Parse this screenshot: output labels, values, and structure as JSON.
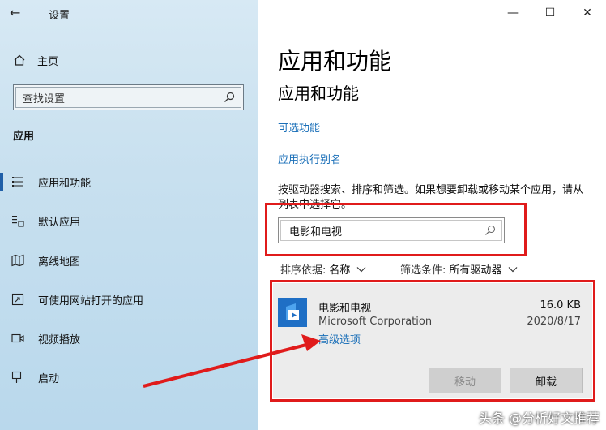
{
  "window": {
    "title": "设置",
    "back_glyph": "←",
    "minimize_glyph": "—",
    "maximize_glyph": "☐",
    "close_glyph": "✕"
  },
  "sidebar": {
    "home_label": "主页",
    "search_placeholder": "查找设置",
    "section_label": "应用",
    "items": [
      {
        "label": "应用和功能",
        "icon": "apps-features-icon",
        "active": true
      },
      {
        "label": "默认应用",
        "icon": "default-apps-icon",
        "active": false
      },
      {
        "label": "离线地图",
        "icon": "offline-maps-icon",
        "active": false
      },
      {
        "label": "可使用网站打开的应用",
        "icon": "apps-for-websites-icon",
        "active": false
      },
      {
        "label": "视频播放",
        "icon": "video-playback-icon",
        "active": false
      },
      {
        "label": "启动",
        "icon": "startup-icon",
        "active": false
      }
    ]
  },
  "main": {
    "page_title": "应用和功能",
    "section_title": "应用和功能",
    "link_optional_features": "可选功能",
    "link_app_aliases": "应用执行别名",
    "description": "按驱动器搜索、排序和筛选。如果想要卸载或移动某个应用，请从列表中选择它。",
    "search_value": "电影和电视",
    "sort_label": "排序依据:",
    "sort_value": "名称",
    "filter_label": "筛选条件:",
    "filter_value": "所有驱动器",
    "app": {
      "name": "电影和电视",
      "publisher": "Microsoft Corporation",
      "size": "16.0 KB",
      "date": "2020/8/17",
      "advanced_options": "高级选项",
      "move_label": "移动",
      "uninstall_label": "卸载"
    }
  },
  "watermark": "头条 @分析好文推荐",
  "colors": {
    "accent": "#1a6fb8",
    "annotation": "#e01b1b",
    "sidebar_bg": "#c8e0ef",
    "app_icon_bg": "#1f6fc5"
  }
}
